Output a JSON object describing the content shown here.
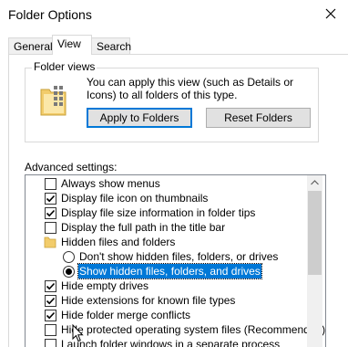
{
  "window": {
    "title": "Folder Options"
  },
  "tabs": [
    {
      "label": "General"
    },
    {
      "label": "View"
    },
    {
      "label": "Search"
    }
  ],
  "folder_views": {
    "group_label": "Folder views",
    "description": "You can apply this view (such as Details or Icons) to all folders of this type.",
    "apply_button": "Apply to Folders",
    "reset_button": "Reset Folders"
  },
  "advanced": {
    "label": "Advanced settings:",
    "items": [
      {
        "kind": "checkbox",
        "label": "Always show menus",
        "checked": false
      },
      {
        "kind": "checkbox",
        "label": "Display file icon on thumbnails",
        "checked": true
      },
      {
        "kind": "checkbox",
        "label": "Display file size information in folder tips",
        "checked": true
      },
      {
        "kind": "checkbox",
        "label": "Display the full path in the title bar",
        "checked": false
      },
      {
        "kind": "folder",
        "label": "Hidden files and folders"
      },
      {
        "kind": "radio",
        "label": "Don't show hidden files, folders, or drives",
        "checked": false
      },
      {
        "kind": "radio",
        "label": "Show hidden files, folders, and drives",
        "checked": true,
        "selected": true
      },
      {
        "kind": "checkbox",
        "label": "Hide empty drives",
        "checked": true
      },
      {
        "kind": "checkbox",
        "label": "Hide extensions for known file types",
        "checked": true
      },
      {
        "kind": "checkbox",
        "label": "Hide folder merge conflicts",
        "checked": true
      },
      {
        "kind": "checkbox",
        "label": "Hide protected operating system files (Recommended)",
        "checked": false
      },
      {
        "kind": "checkbox",
        "label": "Launch folder windows in a separate process",
        "checked": false
      }
    ]
  },
  "colors": {
    "selection": "#0078d7",
    "folder": "#f2cc6b"
  }
}
